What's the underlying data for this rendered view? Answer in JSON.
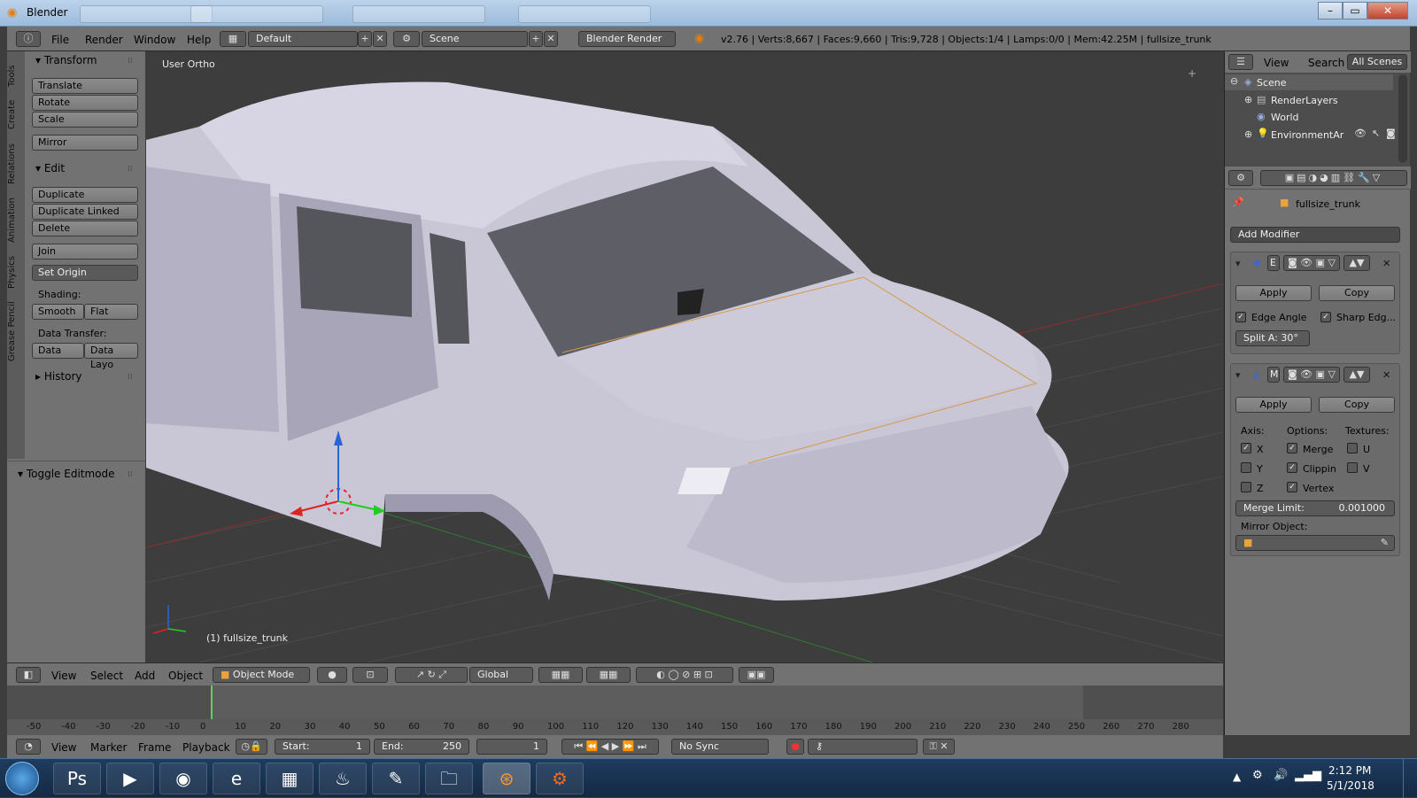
{
  "window": {
    "title": "Blender",
    "min": "–",
    "max": "▭",
    "close": "✕"
  },
  "infobar": {
    "menus": [
      "File",
      "Render",
      "Window",
      "Help"
    ],
    "layout": "Default",
    "scene": "Scene",
    "engine": "Blender Render",
    "stats": "v2.76 | Verts:8,667 | Faces:9,660 | Tris:9,728 | Objects:1/4 | Lamps:0/0 | Mem:42.25M | fullsize_trunk"
  },
  "toolshelf": {
    "tabs": [
      "Tools",
      "Create",
      "Relations",
      "Animation",
      "Physics",
      "Grease Pencil"
    ],
    "transform_title": "Transform",
    "translate": "Translate",
    "rotate": "Rotate",
    "scale": "Scale",
    "mirror": "Mirror",
    "edit_title": "Edit",
    "duplicate": "Duplicate",
    "duplicate_linked": "Duplicate Linked",
    "delete": "Delete",
    "join": "Join",
    "set_origin": "Set Origin",
    "shading_label": "Shading:",
    "smooth": "Smooth",
    "flat": "Flat",
    "data_transfer_label": "Data Transfer:",
    "data": "Data",
    "data_layo": "Data Layo",
    "history": "History",
    "toggle_editmode": "Toggle Editmode"
  },
  "viewport": {
    "view_name": "User Ortho",
    "object_label": "(1) fullsize_trunk"
  },
  "vpheader": {
    "view": "View",
    "select": "Select",
    "add": "Add",
    "object": "Object",
    "mode": "Object Mode",
    "orientation": "Global"
  },
  "timeline": {
    "ticks": [
      "-50",
      "-40",
      "-30",
      "-20",
      "-10",
      "0",
      "10",
      "20",
      "30",
      "40",
      "50",
      "60",
      "70",
      "80",
      "90",
      "100",
      "110",
      "120",
      "130",
      "140",
      "150",
      "160",
      "170",
      "180",
      "190",
      "200",
      "210",
      "220",
      "230",
      "240",
      "250",
      "260",
      "270",
      "280"
    ],
    "current_frame": 0,
    "view": "View",
    "marker": "Marker",
    "frame": "Frame",
    "playback": "Playback",
    "start_label": "Start:",
    "start": "1",
    "end_label": "End:",
    "end": "250",
    "current": "1",
    "sync": "No Sync"
  },
  "outliner": {
    "view": "View",
    "search": "Search",
    "all_scenes": "All Scenes",
    "items": [
      "Scene",
      "RenderLayers",
      "World",
      "EnvironmentAr"
    ]
  },
  "properties": {
    "object_name": "fullsize_trunk",
    "add_modifier": "Add Modifier",
    "mod1_name": "E",
    "apply": "Apply",
    "copy": "Copy",
    "edge_angle": "Edge Angle",
    "sharp_edges": "Sharp Edg...",
    "split_angle": "Split A: 30°",
    "mod2_name": "M",
    "axis": "Axis:",
    "options": "Options:",
    "textures": "Textures:",
    "x": "X",
    "y": "Y",
    "z": "Z",
    "merge": "Merge",
    "clipping": "Clippin",
    "vertex": "Vertex",
    "u": "U",
    "v": "V",
    "merge_limit_label": "Merge Limit:",
    "merge_limit": "0.001000",
    "mirror_object": "Mirror Object:"
  },
  "taskbar": {
    "time": "2:12 PM",
    "date": "5/1/2018",
    "apps": [
      "Ps",
      "▶",
      "◉",
      "e",
      "▦",
      "♨",
      "✎",
      "🗀",
      "⊛",
      "⚙"
    ]
  }
}
